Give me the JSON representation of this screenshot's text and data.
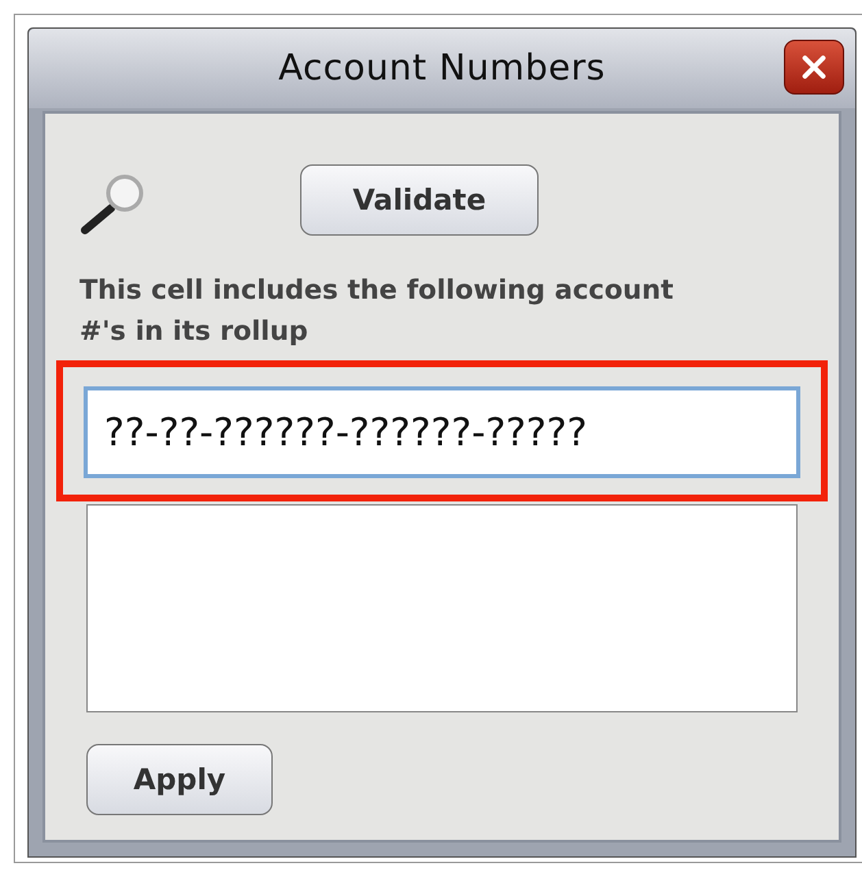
{
  "window": {
    "title": "Account Numbers"
  },
  "validate_button": {
    "label": "Validate"
  },
  "description": "This cell includes the following account #'s in its rollup",
  "account_field": {
    "value": "??-??-??????-??????-?????",
    "focused": true,
    "highlighted": true
  },
  "apply_button": {
    "label": "Apply"
  }
}
